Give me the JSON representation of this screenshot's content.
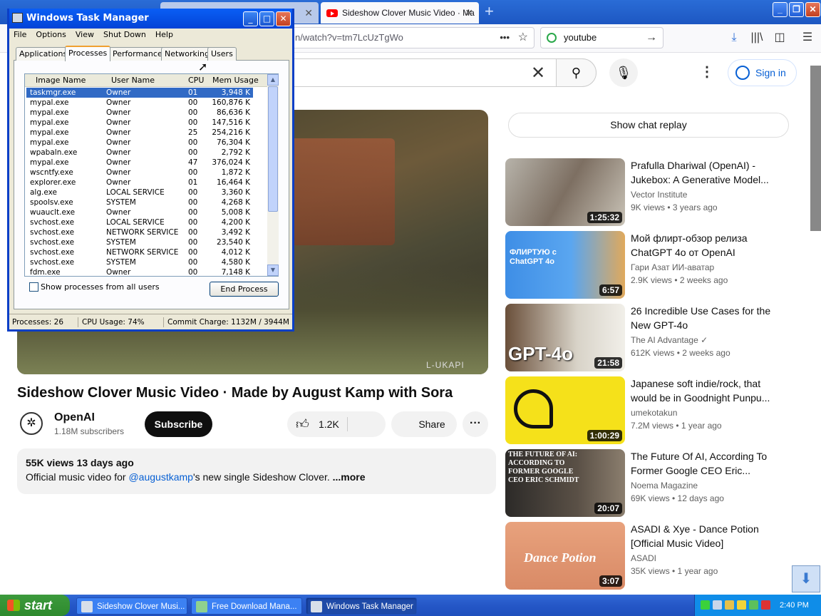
{
  "browser": {
    "active_tab_title": "Sideshow Clover Music Video · Ma",
    "url": "n/watch?v=tm7LcUzTgWo",
    "url_more": "•••",
    "search_value": "youtube",
    "new_tab": "+"
  },
  "youtube": {
    "signin_label": "Sign in",
    "video_title": "Sideshow Clover Music Video · Made by August Kamp with Sora",
    "watermark": "L-UKAPI",
    "channel": {
      "name": "OpenAI",
      "subscribers": "1.18M subscribers"
    },
    "subscribe_label": "Subscribe",
    "likes": "1.2K",
    "share_label": "Share",
    "description": {
      "stats": "55K views  13 days ago",
      "prefix": "Official music video for ",
      "link": "@augustkamp",
      "suffix": "'s new single Sideshow Clover. ",
      "more": "...more"
    },
    "chat_replay_label": "Show chat replay",
    "recommendations": [
      {
        "title": "Prafulla Dhariwal (OpenAI) - Jukebox: A Generative Model...",
        "channel": "Vector Institute",
        "meta": "9K views • 3 years ago",
        "duration": "1:25:32"
      },
      {
        "title": "Мой флирт-обзор релиза ChatGPT 4o от OpenAI",
        "channel": "Гари Азат ИИ-аватар",
        "meta": "2.9K views • 2 weeks ago",
        "duration": "6:57",
        "thumb_text": "ФЛИРТУЮ с ChatGPT 4o"
      },
      {
        "title": "26 Incredible Use Cases for the New GPT-4o",
        "channel": "The AI Advantage ✓",
        "meta": "612K views • 2 weeks ago",
        "duration": "21:58",
        "thumb_text": "GPT-4o"
      },
      {
        "title": "Japanese soft indie/rock, that would be in Goodnight Punpu...",
        "channel": "umekotakun",
        "meta": "7.2M views • 1 year ago",
        "duration": "1:00:29"
      },
      {
        "title": "The Future Of AI, According To Former Google CEO Eric...",
        "channel": "Noema Magazine",
        "meta": "69K views • 12 days ago",
        "duration": "20:07",
        "thumb_text": "THE FUTURE OF AI: ACCORDING TO FORMER GOOGLE CEO ERIC SCHMIDT"
      },
      {
        "title": "ASADI & Xye - Dance Potion [Official Music Video]",
        "channel": "ASADI",
        "meta": "35K views • 1 year ago",
        "duration": "3:07",
        "thumb_text": "Dance Potion"
      }
    ]
  },
  "taskmgr": {
    "title": "Windows Task Manager",
    "menu": [
      "File",
      "Options",
      "View",
      "Shut Down",
      "Help"
    ],
    "tabs": [
      "Applications",
      "Processes",
      "Performance",
      "Networking",
      "Users"
    ],
    "columns": [
      "Image Name",
      "User Name",
      "CPU",
      "Mem Usage"
    ],
    "processes": [
      [
        "taskmgr.exe",
        "Owner",
        "01",
        "3,948 K"
      ],
      [
        "mypal.exe",
        "Owner",
        "00",
        "160,876 K"
      ],
      [
        "mypal.exe",
        "Owner",
        "00",
        "86,636 K"
      ],
      [
        "mypal.exe",
        "Owner",
        "00",
        "147,516 K"
      ],
      [
        "mypal.exe",
        "Owner",
        "25",
        "254,216 K"
      ],
      [
        "mypal.exe",
        "Owner",
        "00",
        "76,304 K"
      ],
      [
        "wpabaln.exe",
        "Owner",
        "00",
        "2,792 K"
      ],
      [
        "mypal.exe",
        "Owner",
        "47",
        "376,024 K"
      ],
      [
        "wscntfy.exe",
        "Owner",
        "00",
        "1,872 K"
      ],
      [
        "explorer.exe",
        "Owner",
        "01",
        "16,464 K"
      ],
      [
        "alg.exe",
        "LOCAL SERVICE",
        "00",
        "3,360 K"
      ],
      [
        "spoolsv.exe",
        "SYSTEM",
        "00",
        "4,268 K"
      ],
      [
        "wuauclt.exe",
        "Owner",
        "00",
        "5,008 K"
      ],
      [
        "svchost.exe",
        "LOCAL SERVICE",
        "00",
        "4,200 K"
      ],
      [
        "svchost.exe",
        "NETWORK SERVICE",
        "00",
        "3,492 K"
      ],
      [
        "svchost.exe",
        "SYSTEM",
        "00",
        "23,540 K"
      ],
      [
        "svchost.exe",
        "NETWORK SERVICE",
        "00",
        "4,012 K"
      ],
      [
        "svchost.exe",
        "SYSTEM",
        "00",
        "4,580 K"
      ],
      [
        "fdm.exe",
        "Owner",
        "00",
        "7,148 K"
      ]
    ],
    "show_all_label": "Show processes from all users",
    "end_process_label": "End Process",
    "status": {
      "processes": "Processes: 26",
      "cpu": "CPU Usage: 74%",
      "commit": "Commit Charge: 1132M / 3944M"
    }
  },
  "taskbar": {
    "start_label": "start",
    "buttons": [
      "Sideshow Clover Musi...",
      "Free Download Mana...",
      "Windows Task Manager"
    ],
    "clock": "2:40 PM"
  }
}
